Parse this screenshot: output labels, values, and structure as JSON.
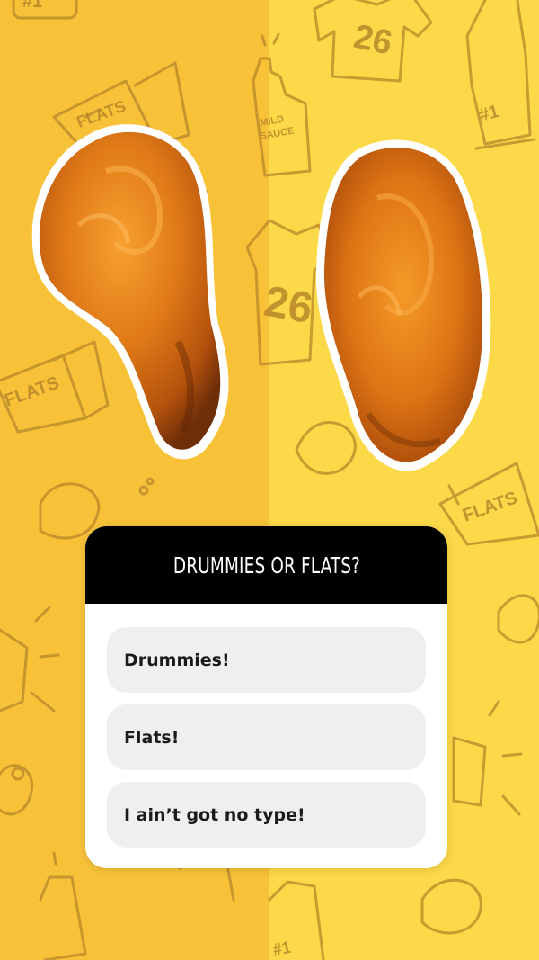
{
  "poll": {
    "question": "DRUMMIES OR FLATS?",
    "options": [
      {
        "label": "Drummies!"
      },
      {
        "label": "Flats!"
      },
      {
        "label": "I ain’t got no type!"
      }
    ]
  },
  "background": {
    "left_color": "#f7c238",
    "right_color": "#fcd948",
    "doodle_color": "#b8862a",
    "doodle_text": [
      "FLATS",
      "MILD SAUCE",
      "26",
      "#1"
    ]
  },
  "images": {
    "left": "drumstick-wing",
    "right": "flat-wing"
  }
}
